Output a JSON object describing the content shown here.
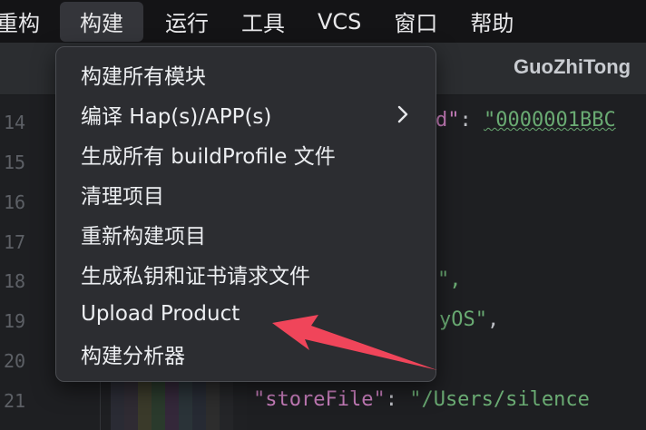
{
  "menubar": {
    "items": [
      "重构",
      "构建",
      "运行",
      "工具",
      "VCS",
      "窗口",
      "帮助"
    ],
    "active_index": 1
  },
  "tab": {
    "title": "GuoZhiTong"
  },
  "editor": {
    "line_numbers": [
      "14",
      "15",
      "16",
      "17",
      "18",
      "19",
      "20",
      "21"
    ],
    "visible_code": {
      "line14": {
        "key_tail": "d\"",
        "colon": ": ",
        "value": "\"0000001BBC"
      },
      "line18": {
        "text": "\","
      },
      "line19": {
        "text_value": "yOS\"",
        "text_punct": ","
      },
      "line21": {
        "key": "\"storeFile\"",
        "colon": ": ",
        "value": "\"/Users/silence"
      }
    }
  },
  "build_menu": {
    "items": [
      {
        "label": "构建所有模块",
        "submenu": false
      },
      {
        "label": "编译 Hap(s)/APP(s)",
        "submenu": true
      },
      {
        "label": "生成所有 buildProfile 文件",
        "submenu": false
      },
      {
        "label": "清理项目",
        "submenu": false
      },
      {
        "label": "重新构建项目",
        "submenu": false
      },
      {
        "label": "生成私钥和证书请求文件",
        "submenu": false
      },
      {
        "label": "Upload Product",
        "submenu": false
      },
      {
        "label": "构建分析器",
        "submenu": false
      }
    ]
  },
  "annotation": {
    "arrow_color": "#f0455a",
    "points_to": "Upload Product"
  },
  "colors": {
    "background": "#1e1f22",
    "menu_bg": "#2c2d31",
    "keyword": "#c77dbb",
    "string": "#6aab73"
  }
}
